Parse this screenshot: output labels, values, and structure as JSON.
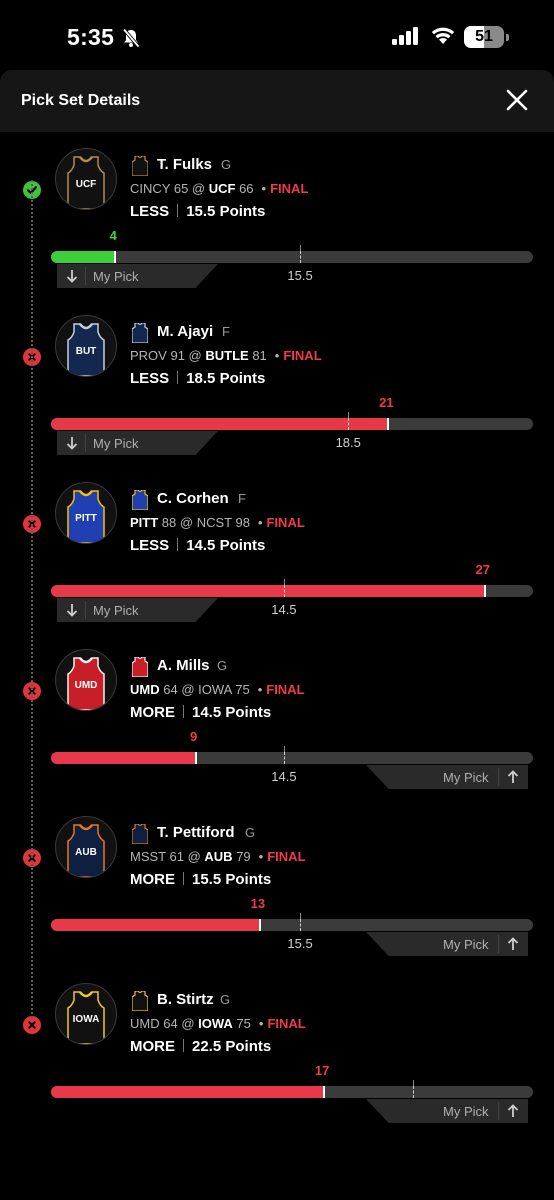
{
  "status_bar": {
    "time": "5:35",
    "battery": "51",
    "battery_level": 0.51
  },
  "sheet": {
    "title": "Pick Set Details"
  },
  "picks": [
    {
      "name": "T. Fulks",
      "pos": "G",
      "team_code": "UCF",
      "result": "hit",
      "away": "CINCY",
      "away_score": "65",
      "home": "UCF",
      "home_score": "66",
      "bold_team": "home",
      "status": "FINAL",
      "direction": "LESS",
      "line": "15.5",
      "unit": "Points",
      "actual": "4",
      "my_pick": "My Pick",
      "jersey_color": "#111111",
      "trim_color": "#b38e4a"
    },
    {
      "name": "M. Ajayi",
      "pos": "F",
      "team_code": "BUT",
      "result": "miss",
      "away": "PROV",
      "away_score": "91",
      "home": "BUTLE",
      "home_score": "81",
      "bold_team": "home",
      "status": "FINAL",
      "direction": "LESS",
      "line": "18.5",
      "unit": "Points",
      "actual": "21",
      "my_pick": "My Pick",
      "jersey_color": "#13284e",
      "trim_color": "#c5cfe0"
    },
    {
      "name": "C. Corhen",
      "pos": "F",
      "team_code": "PITT",
      "result": "miss",
      "away": "PITT",
      "away_score": "88",
      "home": "NCST",
      "home_score": "98",
      "bold_team": "away",
      "status": "FINAL",
      "direction": "LESS",
      "line": "14.5",
      "unit": "Points",
      "actual": "27",
      "my_pick": "My Pick",
      "jersey_color": "#1f3fb3",
      "trim_color": "#f2c300"
    },
    {
      "name": "A. Mills",
      "pos": "G",
      "team_code": "UMD",
      "result": "miss",
      "away": "UMD",
      "away_score": "64",
      "home": "IOWA",
      "home_score": "75",
      "bold_team": "away",
      "status": "FINAL",
      "direction": "MORE",
      "line": "14.5",
      "unit": "Points",
      "actual": "9",
      "my_pick": "My Pick",
      "jersey_color": "#c81e28",
      "trim_color": "#f2f2f2"
    },
    {
      "name": "T. Pettiford",
      "pos": "G",
      "team_code": "AUB",
      "result": "miss",
      "away": "MSST",
      "away_score": "61",
      "home": "AUB",
      "home_score": "79",
      "bold_team": "home",
      "status": "FINAL",
      "direction": "MORE",
      "line": "15.5",
      "unit": "Points",
      "actual": "13",
      "my_pick": "My Pick",
      "jersey_color": "#0f1f3f",
      "trim_color": "#e87722"
    },
    {
      "name": "B. Stirtz",
      "pos": "G",
      "team_code": "IOWA",
      "result": "miss",
      "away": "UMD",
      "away_score": "64",
      "home": "IOWA",
      "home_score": "75",
      "bold_team": "home",
      "status": "FINAL",
      "direction": "MORE",
      "line": "22.5",
      "unit": "Points",
      "actual": "17",
      "my_pick": "My Pick",
      "jersey_color": "#111111",
      "trim_color": "#f4c430"
    }
  ]
}
